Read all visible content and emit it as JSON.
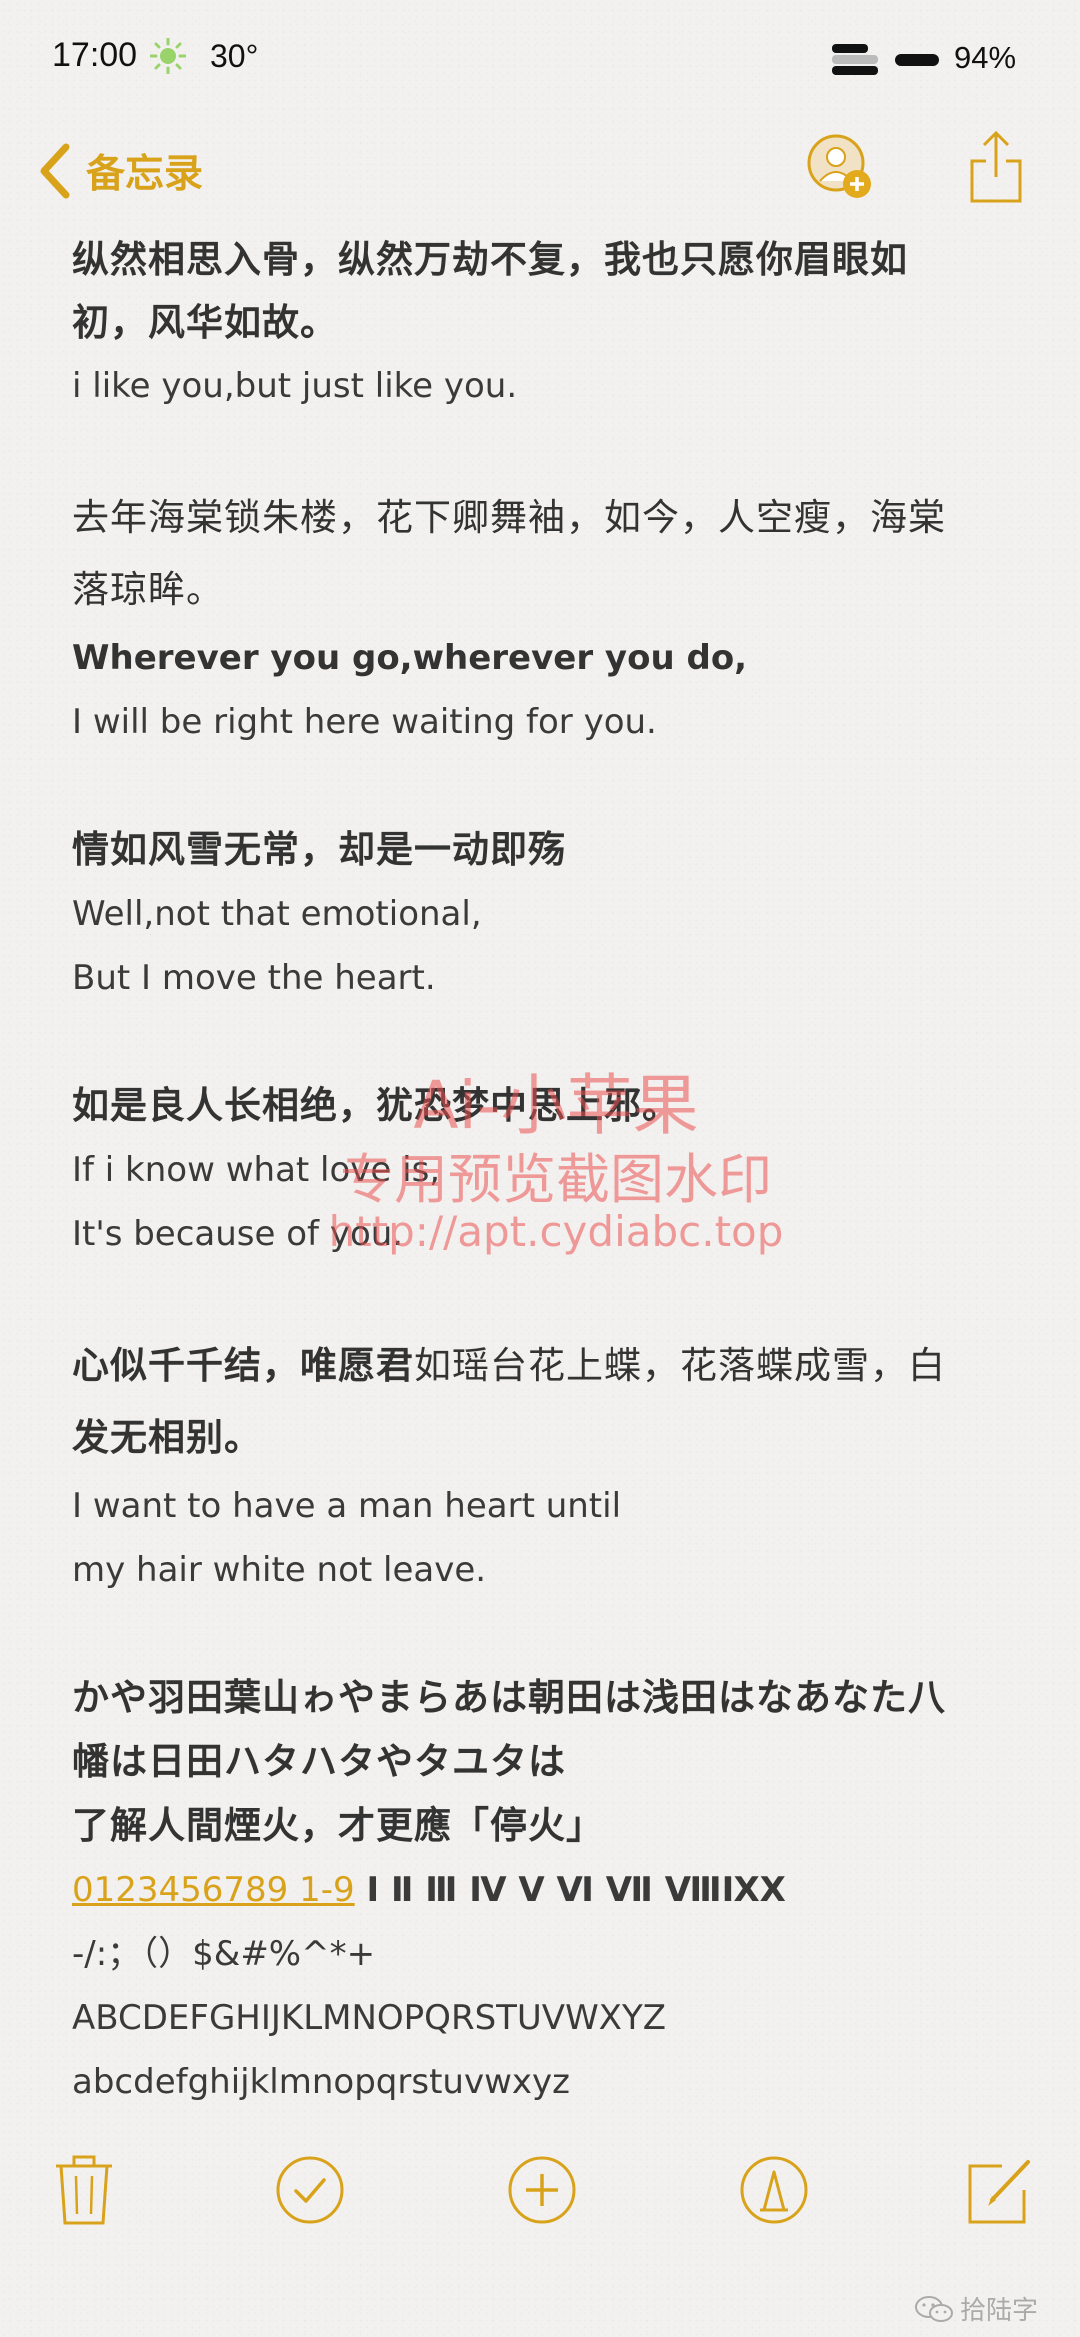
{
  "status_bar": {
    "time": "17:00",
    "weather_icon": "sun-icon",
    "temperature": "30°",
    "battery": "94%"
  },
  "nav": {
    "back_label": "备忘录",
    "back_icon": "chevron-left-icon",
    "collab_icon": "add-person-icon",
    "share_icon": "share-icon"
  },
  "note": {
    "lines": {
      "l1": "纵然相思入骨，纵然万劫不复，我也只愿你眉眼如",
      "l2": "初，风华如故。",
      "l3": "i like you,but just like you.",
      "l4": "去年海棠锁朱楼，花下卿舞袖，如今，人空瘦，海棠",
      "l5": "落琼眸。",
      "l6": "Wherever you go,wherever you do,",
      "l7": "I will be right here waiting for you.",
      "l8": "情如风雪无常，却是一动即殇",
      "l9": "Well,not that emotional,",
      "l10": "But I move the heart.",
      "l11": "如是良人长相绝，犹恐梦中思上邪。",
      "l12": "If i know what love is,",
      "l13": "It's because of you.",
      "l14a": "心似千千结，唯愿君",
      "l14b": "如瑶台花上蝶，花落蝶成雪，白",
      "l15": "发无相别。",
      "l16": "I want to have a man heart until",
      "l17": "my hair white not leave.",
      "l18": "かや羽田葉山ゎやまらあは朝田は浅田はなあなた八",
      "l19": "幡は日田ハタハタやタユタは",
      "l20": "了解人間煙火，才更應「停火」",
      "l21_link": "0123456789 1-9",
      "l21_roman": " Ⅰ Ⅱ Ⅲ Ⅳ Ⅴ Ⅵ Ⅶ ⅧⅨⅩ",
      "l22": "-/:；（）$&#%^*+",
      "l23": "ABCDEFGHIJKLMNOPQRSTUVWXYZ",
      "l24": "abcdefghijklmnopqrstuvwxyz"
    }
  },
  "watermark": {
    "line1": "Ai-小苹果",
    "line2": "专用预览截图水印",
    "line3": "http://apt.cydiabc.top"
  },
  "toolbar": {
    "items": [
      "trash-icon",
      "checklist-icon",
      "add-icon",
      "markup-icon",
      "compose-icon"
    ]
  },
  "credit": {
    "icon": "wechat-icon",
    "text": "拾陆字"
  },
  "colors": {
    "accent": "#d9a21b",
    "text": "#333333",
    "background": "#f2f1ef",
    "watermark": "#eb5050"
  }
}
